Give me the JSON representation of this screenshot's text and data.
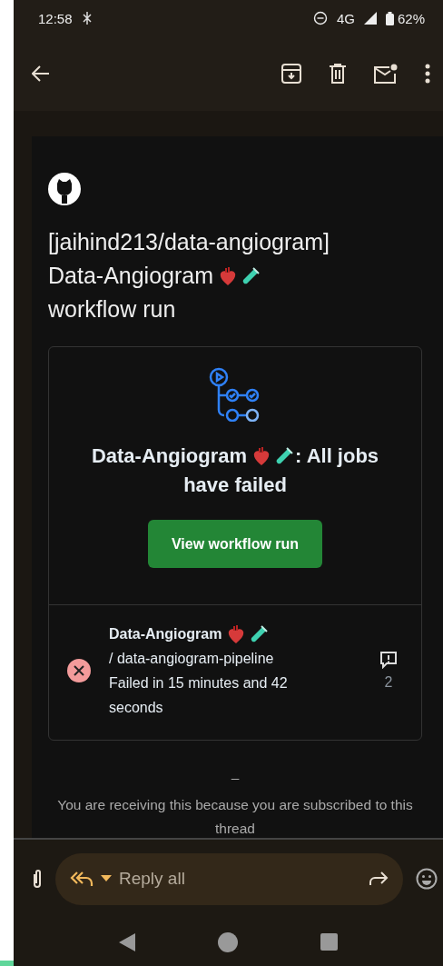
{
  "status_bar": {
    "time": "12:58",
    "network": "4G",
    "battery": "62%"
  },
  "subject": {
    "repo": "[jaihind213/data-angiogram]",
    "workflow": "Data-Angiogram",
    "suffix": "workflow run"
  },
  "card": {
    "heading_name": "Data-Angiogram",
    "heading_rest": ": All jobs",
    "heading_line_2": "have failed",
    "button": "View workflow run",
    "job": {
      "failed": true,
      "workflow": "Data-Angiogram",
      "job_name": "/ data-angiogram-pipeline",
      "duration": "Failed in 15 minutes and 42 seconds",
      "annotations": "2"
    }
  },
  "footer": {
    "separator": "–",
    "notice": "You are receiving this because you are subscribed to this thread"
  },
  "composer": {
    "placeholder": "Reply all"
  }
}
